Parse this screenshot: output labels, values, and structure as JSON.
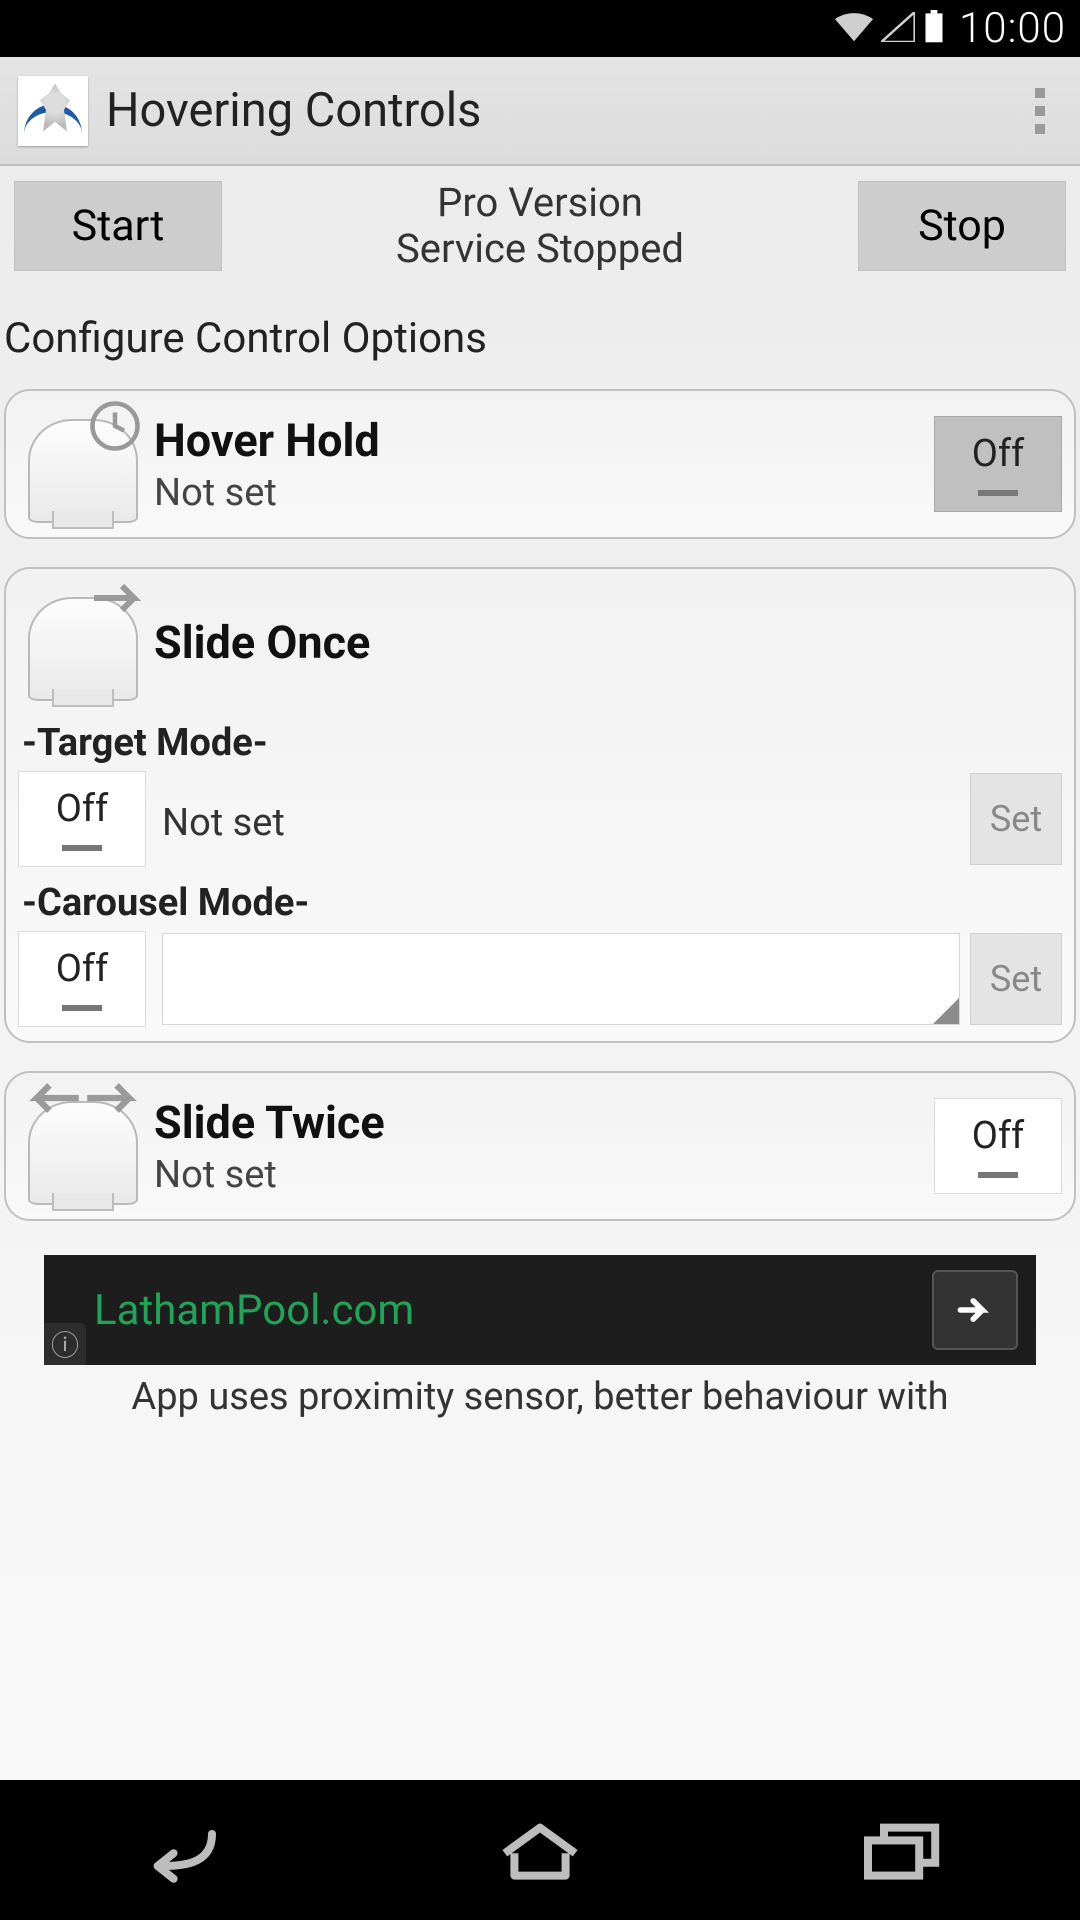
{
  "status": {
    "time": "10:00"
  },
  "appbar": {
    "title": "Hovering Controls"
  },
  "top": {
    "start_label": "Start",
    "stop_label": "Stop",
    "version_line": "Pro Version",
    "service_line": "Service Stopped"
  },
  "section_heading": "Configure Control Options",
  "hover_hold": {
    "title": "Hover Hold",
    "subtitle": "Not set",
    "toggle": "Off"
  },
  "slide_once": {
    "title": "Slide Once",
    "target_label": "-Target Mode-",
    "target_toggle": "Off",
    "target_value": "Not set",
    "target_set": "Set",
    "carousel_label": "-Carousel Mode-",
    "carousel_toggle": "Off",
    "carousel_set": "Set"
  },
  "slide_twice": {
    "title": "Slide Twice",
    "subtitle": "Not set",
    "toggle": "Off"
  },
  "ad": {
    "text": "LathamPool.com"
  },
  "footer": {
    "note": "App uses proximity sensor, better behaviour with"
  }
}
